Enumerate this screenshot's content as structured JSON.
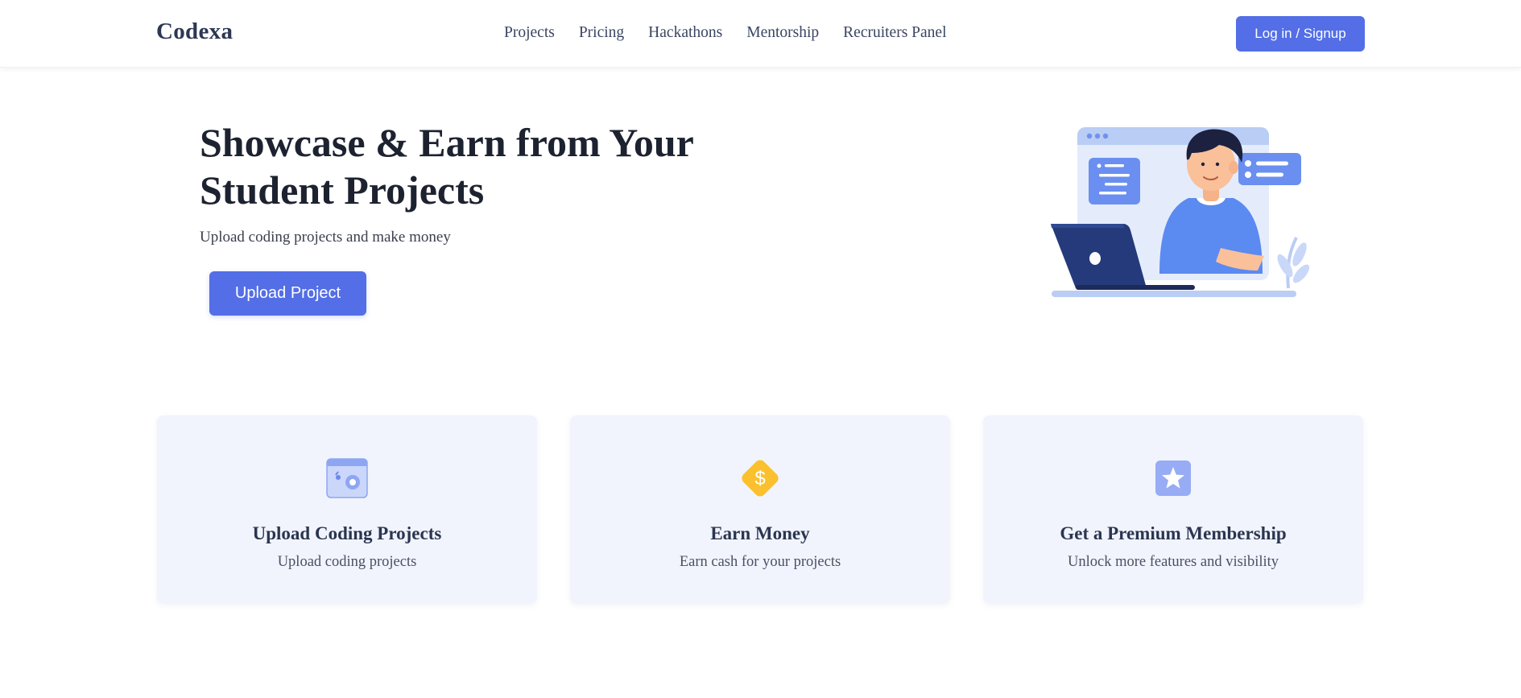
{
  "header": {
    "logo": "Codexa",
    "nav": [
      "Projects",
      "Pricing",
      "Hackathons",
      "Mentorship",
      "Recruiters Panel"
    ],
    "login_label": "Log in / Signup"
  },
  "hero": {
    "title": "Showcase & Earn from Your Student Projects",
    "subtitle": "Upload coding projects and make money",
    "cta_label": "Upload Project",
    "illustration": "developer-at-laptop-illustration"
  },
  "features": [
    {
      "icon": "upload-code-icon",
      "title": "Upload Coding Projects",
      "description": "Upload coding projects"
    },
    {
      "icon": "dollar-icon",
      "title": "Earn Money",
      "description": "Earn cash for your projects"
    },
    {
      "icon": "star-icon",
      "title": "Get a Premium Membership",
      "description": "Unlock more features and visibility"
    }
  ],
  "colors": {
    "accent": "#536ee6",
    "card_bg": "#f1f4fc",
    "dollar": "#fbc02d",
    "heading": "#1d2230"
  }
}
